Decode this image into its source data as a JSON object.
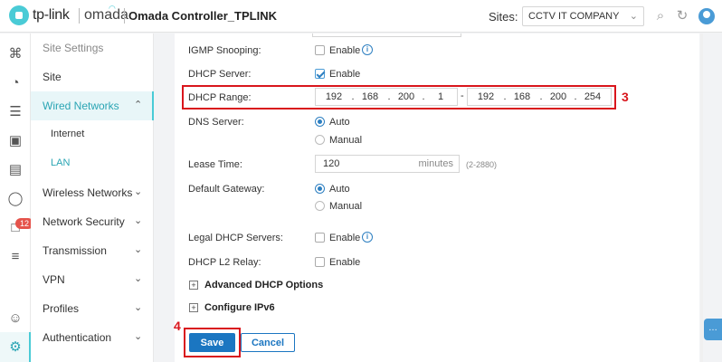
{
  "header": {
    "brand": "tp-link",
    "product": "omada",
    "title": "Omada Controller_TPLINK",
    "sites_label": "Sites:",
    "site_selected": "CCTV IT COMPANY"
  },
  "rail": {
    "badge_count": "12"
  },
  "sidebar": {
    "items": [
      {
        "label": "Site Settings"
      },
      {
        "label": "Site"
      },
      {
        "label": "Wired Networks"
      },
      {
        "label": "Internet"
      },
      {
        "label": "LAN"
      },
      {
        "label": "Wireless Networks"
      },
      {
        "label": "Network Security"
      },
      {
        "label": "Transmission"
      },
      {
        "label": "VPN"
      },
      {
        "label": "Profiles"
      },
      {
        "label": "Authentication"
      }
    ]
  },
  "form": {
    "igmp": {
      "label": "IGMP Snooping:",
      "option": "Enable",
      "checked": false
    },
    "dhcp_server": {
      "label": "DHCP Server:",
      "option": "Enable",
      "checked": true
    },
    "dhcp_range": {
      "label": "DHCP Range:",
      "start": [
        "192",
        "168",
        "200",
        "1"
      ],
      "end": [
        "192",
        "168",
        "200",
        "254"
      ],
      "separator": "-"
    },
    "dns": {
      "label": "DNS Server:",
      "options": [
        "Auto",
        "Manual"
      ],
      "selected": "Auto"
    },
    "lease": {
      "label": "Lease Time:",
      "value": "120",
      "unit": "minutes",
      "hint": "(2-2880)"
    },
    "gateway": {
      "label": "Default Gateway:",
      "options": [
        "Auto",
        "Manual"
      ],
      "selected": "Auto"
    },
    "legal_dhcp": {
      "label": "Legal DHCP Servers:",
      "option": "Enable",
      "checked": false
    },
    "l2_relay": {
      "label": "DHCP L2 Relay:",
      "option": "Enable",
      "checked": false
    },
    "advanced": {
      "label": "Advanced DHCP Options"
    },
    "ipv6": {
      "label": "Configure IPv6"
    }
  },
  "actions": {
    "save": "Save",
    "cancel": "Cancel"
  },
  "annotations": {
    "step3": "3",
    "step4": "4",
    "color": "#d9151c"
  }
}
